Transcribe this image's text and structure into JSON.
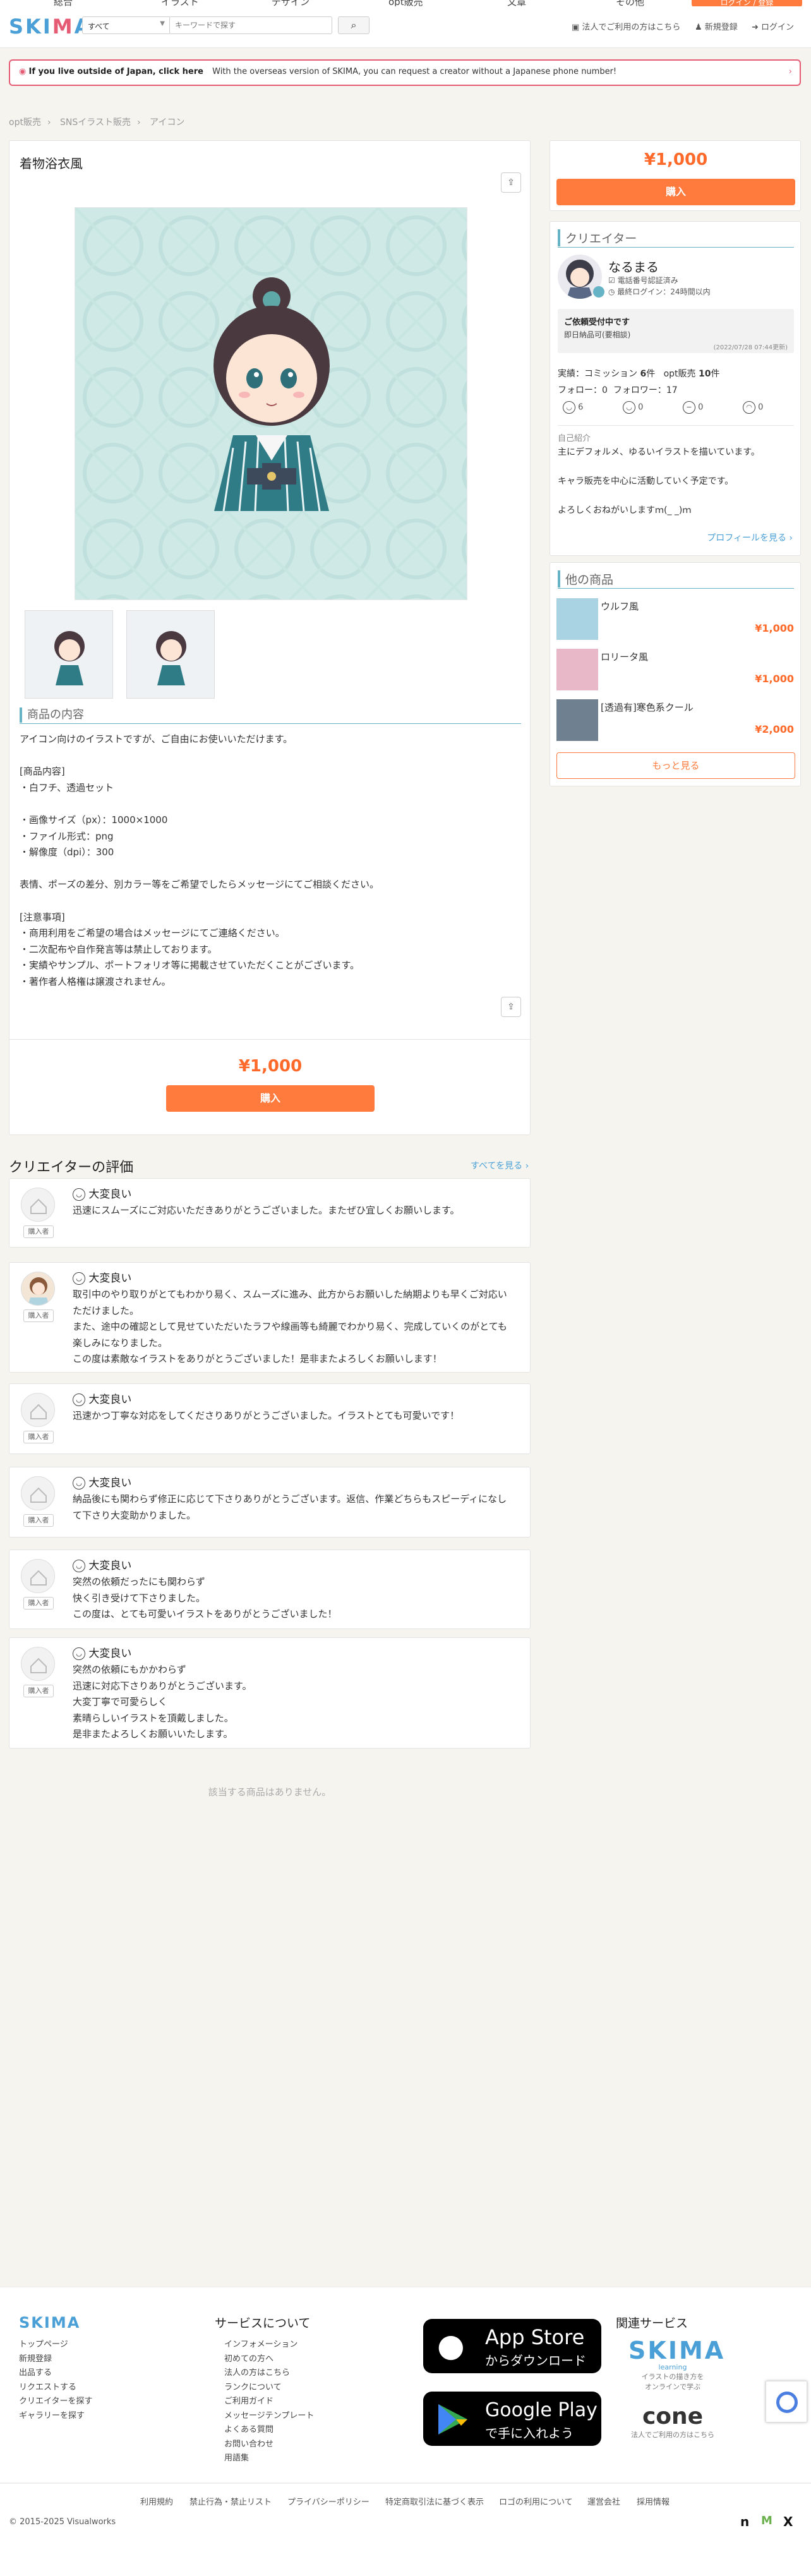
{
  "top_nav": {
    "items": [
      "総合",
      "イラスト",
      "デザイン",
      "opt販売",
      "文章",
      "その他"
    ],
    "cta": "ログイン / 登録"
  },
  "header": {
    "logo": "SKIMA",
    "category": "すべて",
    "search_placeholder": "キーワードで探す",
    "corp_link": "法人でご利用の方はこちら",
    "register": "新規登録",
    "login": "ログイン"
  },
  "notice": {
    "bold": "If you live outside of Japan, click here",
    "text": "With the overseas version of SKIMA, you can request a creator without a Japanese phone number!"
  },
  "breadcrumb": [
    "opt販売",
    "SNSイラスト販売",
    "アイコン"
  ],
  "product": {
    "title": "着物浴衣風",
    "section_title": "商品の内容",
    "description": [
      "アイコン向けのイラストですが、ご自由にお使いいただけます。",
      "",
      "[商品内容]",
      "・白フチ、透過セット",
      "",
      "・画像サイズ（px）：1000×1000",
      "・ファイル形式：png",
      "・解像度（dpi）：300",
      "",
      "表情、ポーズの差分、別カラー等をご希望でしたらメッセージにてご相談ください。",
      "",
      "[注意事項]",
      "・商用利用をご希望の場合はメッセージにてご連絡ください。",
      "・二次配布や自作発言等は禁止しております。",
      "・実績やサンプル、ポートフォリオ等に掲載させていただくことがございます。",
      "・著作者人格権は譲渡されません。"
    ],
    "price": "¥1,000",
    "buy_label": "購入"
  },
  "sidebar": {
    "price": "¥1,000",
    "buy_label": "購入",
    "creator_heading": "クリエイター",
    "creator": {
      "name": "なるまる",
      "verified": "電話番号認証済み",
      "last_login": "最終ログイン：24時間以内",
      "status_title": "ご依頼受付中です",
      "status_note": "即日納品可(要相談)",
      "status_updated": "(2022/07/28 07:44更新)",
      "stats": "実績：コミッション",
      "commission_count": "6",
      "commission_unit": "件",
      "opt_label": "opt販売",
      "opt_count": "10",
      "opt_unit": "件",
      "follow": "フォロー：0",
      "followers": "フォロワー：17",
      "ratings": [
        "6",
        "0",
        "0",
        "0"
      ],
      "intro_label": "自己紹介",
      "intro": [
        "主にデフォルメ、ゆるいイラストを描いています。",
        "",
        "キャラ販売を中心に活動していく予定です。",
        "",
        "よろしくおねがいしますｍ(_ _)ｍ"
      ],
      "profile_link": "プロフィールを見る ›"
    },
    "other_heading": "他の商品",
    "other_items": [
      {
        "title": "ウルフ風",
        "price": "¥1,000"
      },
      {
        "title": "ロリータ風",
        "price": "¥1,000"
      },
      {
        "title": "[透過有]寒色系クール",
        "price": "¥2,000"
      }
    ],
    "more_label": "もっと見る"
  },
  "reviews": {
    "title": "クリエイターの評価",
    "all_link": "すべてを見る ›",
    "badge": "購入者",
    "items": [
      {
        "rating": "大変良い",
        "lines": [
          "迅速にスムーズにご対応いただきありがとうございました。またぜひ宜しくお願いします。"
        ]
      },
      {
        "rating": "大変良い",
        "lines": [
          "取引中のやり取りがとてもわかり易く、スムーズに進み、此方からお願いした納期よりも早くご対応いただけました。",
          "また、途中の確認として見せていただいたラフや線画等も綺麗でわかり易く、完成していくのがとても楽しみになりました。",
          "この度は素敵なイラストをありがとうございました！是非またよろしくお願いします！"
        ]
      },
      {
        "rating": "大変良い",
        "lines": [
          "迅速かつ丁寧な対応をしてくださりありがとうございました。イラストとても可愛いです！"
        ]
      },
      {
        "rating": "大変良い",
        "lines": [
          "納品後にも関わらず修正に応じて下さりありがとうございます。返信、作業どちらもスピーディになして下さり大変助かりました。"
        ]
      },
      {
        "rating": "大変良い",
        "lines": [
          "突然の依頼だったにも関わらず",
          "快く引き受けて下さりました。",
          "この度は、とても可愛いイラストをありがとうございました！"
        ]
      },
      {
        "rating": "大変良い",
        "lines": [
          "突然の依頼にもかかわらず",
          "迅速に対応下さりありがとうございます。",
          "大変丁寧で可愛らしく",
          "素晴らしいイラストを頂戴しました。",
          "是非またよろしくお願いいたします。"
        ]
      }
    ]
  },
  "no_items": "該当する商品はありません。",
  "footer": {
    "logo": "SKIMA",
    "links_col1": [
      "トップページ",
      "新規登録",
      "出品する",
      "リクエストする",
      "クリエイターを探す",
      "ギャラリーを探す"
    ],
    "service_title": "サービスについて",
    "links_col2": [
      "インフォメーション",
      "初めての方へ",
      "法人の方はこちら",
      "ランクについて",
      "ご利用ガイド",
      "メッセージテンプレート",
      "よくある質問",
      "お問い合わせ",
      "用語集"
    ],
    "appstore_line1": "App Store",
    "appstore_line2": "からダウンロード",
    "googleplay_line1": "Google Play",
    "googleplay_line2": "で手に入れよう",
    "related_title": "関連サービス",
    "skima_learning": "SKIMA",
    "skima_learning_sub": "learning",
    "skima_learning_desc1": "イラストの描き方を",
    "skima_learning_desc2": "オンラインで学ぶ",
    "cone": "cone",
    "cone_desc": "法人でご利用の方はこちら",
    "legal_links": [
      "利用規約",
      "禁止行為・禁止リスト",
      "プライバシーポリシー",
      "特定商取引法に基づく表示",
      "ロゴの利用について",
      "運営会社",
      "採用情報"
    ],
    "copyright": "© 2015-2025 Visualworks"
  },
  "colors": {
    "accent": "#ff7a3d",
    "price": "#ff6a2b",
    "teal": "#67b3c6",
    "link": "#4aa0d6",
    "pink": "#e55b74"
  }
}
